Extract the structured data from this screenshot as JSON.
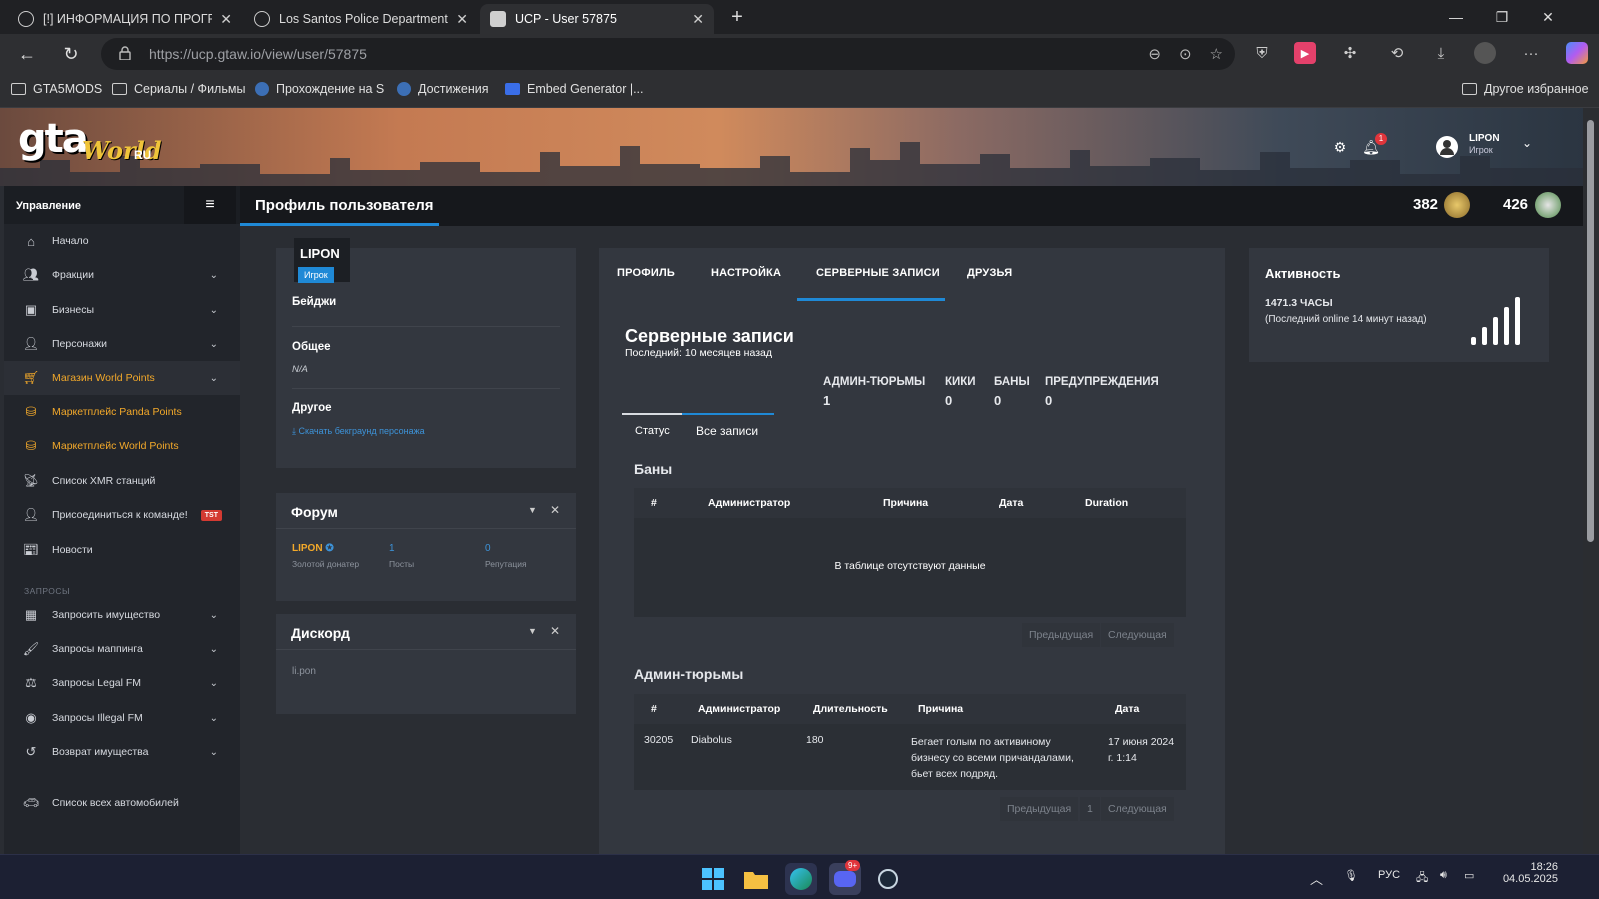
{
  "browser": {
    "tabs": [
      {
        "title": "[!] ИНФОРМАЦИЯ ПО ПРОГРАМ"
      },
      {
        "title": "Los Santos Police Department - H"
      },
      {
        "title": "UCP - User 57875"
      }
    ],
    "url": "https://ucp.gtaw.io/view/user/57875",
    "bookmarks": [
      {
        "label": "GTA5MODS"
      },
      {
        "label": "Сериалы / Фильмы"
      },
      {
        "label": "Прохождение на S"
      },
      {
        "label": "Достижения"
      },
      {
        "label": "Embed Generator |..."
      }
    ],
    "other_favorites": "Другое избранное"
  },
  "site": {
    "logo_gta": "gta",
    "logo_world": "World",
    "logo_ru": "RU",
    "notifications": "1",
    "user_name": "LIPON",
    "user_role": "Игрок"
  },
  "sidebar": {
    "title": "Управление",
    "items": [
      {
        "label": "Начало",
        "icon": "home-icon"
      },
      {
        "label": "Фракции",
        "icon": "users-icon"
      },
      {
        "label": "Бизнесы",
        "icon": "briefcase-icon"
      },
      {
        "label": "Персонажи",
        "icon": "user-icon"
      },
      {
        "label": "Магазин World Points",
        "icon": "cart-icon"
      },
      {
        "label": "Маркетплейс Panda Points",
        "icon": "coins-icon"
      },
      {
        "label": "Маркетплейс World Points",
        "icon": "coins-icon"
      },
      {
        "label": "Список XMR станций",
        "icon": "antenna-icon"
      },
      {
        "label": "Присоединиться к команде!",
        "icon": "user-plus-icon",
        "badge": "TST"
      },
      {
        "label": "Новости",
        "icon": "newspaper-icon"
      }
    ],
    "requests_section": "ЗАПРОСЫ",
    "requests": [
      {
        "label": "Запросить имущество",
        "icon": "building-icon"
      },
      {
        "label": "Запросы маппинга",
        "icon": "brush-icon"
      },
      {
        "label": "Запросы Legal FM",
        "icon": "scale-icon"
      },
      {
        "label": "Запросы Illegal FM",
        "icon": "mask-icon"
      },
      {
        "label": "Возврат имущества",
        "icon": "undo-icon"
      }
    ],
    "vehicles": "Список всех автомобилей"
  },
  "topbar": {
    "title": "Профиль пользователя",
    "points_a": "382",
    "points_b": "426"
  },
  "profile_card": {
    "name": "LIPON",
    "role": "Игрок",
    "badges_label": "Бейджи",
    "general_label": "Общее",
    "general_value": "N/A",
    "other_label": "Другое",
    "download_link": "Скачать бекграунд персонажа"
  },
  "forum_card": {
    "title": "Форум",
    "name": "LIPON",
    "rank": "Золотой донатер",
    "posts": "1",
    "posts_label": "Посты",
    "reputation": "0",
    "reputation_label": "Репутация"
  },
  "discord_card": {
    "title": "Дискорд",
    "username": "li.pon"
  },
  "main_tabs": [
    "ПРОФИЛЬ",
    "НАСТРОЙКА",
    "СЕРВЕРНЫЕ ЗАПИСИ",
    "ДРУЗЬЯ"
  ],
  "records": {
    "title": "Серверные записи",
    "last": "Последний: 10 месяцев назад",
    "stats": [
      {
        "label": "АДМИН-ТЮРЬМЫ",
        "value": "1"
      },
      {
        "label": "КИКИ",
        "value": "0"
      },
      {
        "label": "БАНЫ",
        "value": "0"
      },
      {
        "label": "ПРЕДУПРЕЖДЕНИЯ",
        "value": "0"
      }
    ],
    "subtabs": [
      "Статус",
      "Все записи"
    ],
    "bans": {
      "title": "Баны",
      "columns": [
        "#",
        "Администратор",
        "Причина",
        "Дата",
        "Duration"
      ],
      "empty": "В таблице отсутствуют данные",
      "prev": "Предыдущая",
      "next": "Следующая"
    },
    "jails": {
      "title": "Админ-тюрьмы",
      "columns": [
        "#",
        "Администратор",
        "Длительность",
        "Причина",
        "Дата"
      ],
      "rows": [
        {
          "id": "30205",
          "admin": "Diabolus",
          "duration": "180",
          "reason": "Бегает голым по активиному бизнесу со всеми причандалами, бьет всех подряд.",
          "date": "17 июня 2024 г. 1:14"
        }
      ],
      "prev": "Предыдущая",
      "page": "1",
      "next": "Следующая"
    }
  },
  "activity": {
    "title": "Активность",
    "hours": "1471.3 ЧАСЫ",
    "last_online": "(Последний online 14 минут назад)"
  },
  "taskbar": {
    "discord_badge": "9+",
    "lang": "РУС",
    "time": "18:26",
    "date": "04.05.2025"
  }
}
